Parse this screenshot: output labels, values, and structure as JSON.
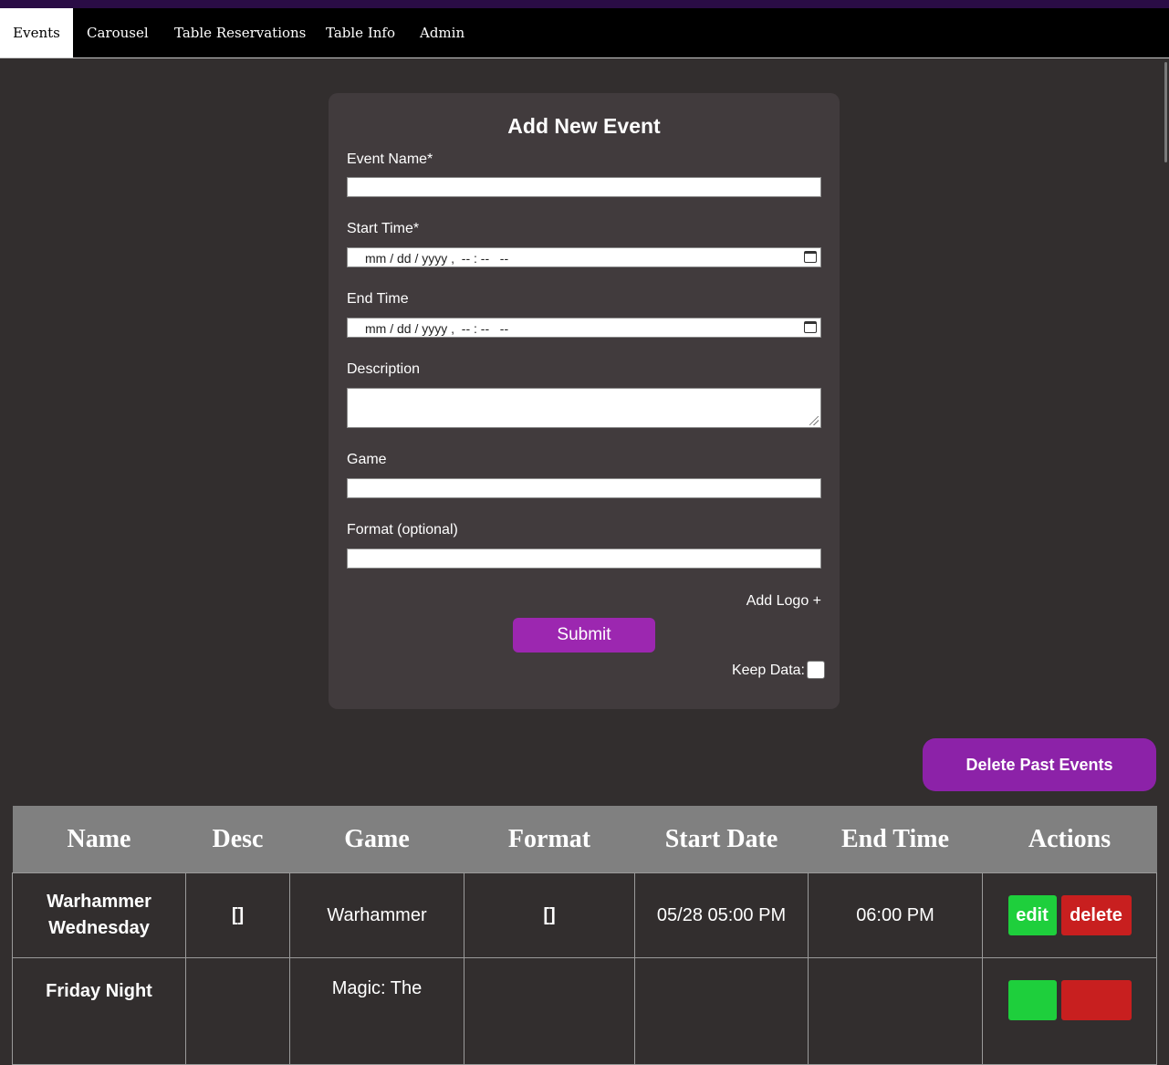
{
  "nav": {
    "items": [
      "Events",
      "Carousel",
      "Table Reservations",
      "Table Info",
      "Admin"
    ],
    "active": "Events"
  },
  "form": {
    "title": "Add New Event",
    "event_name_label": "Event Name*",
    "start_time_label": "Start Time*",
    "start_time_placeholder": "mm / dd / yyyy ,  -- : --   --",
    "end_time_label": "End Time",
    "end_time_placeholder": "mm / dd / yyyy ,  -- : --   --",
    "description_label": "Description",
    "game_label": "Game",
    "format_label": "Format (optional)",
    "add_logo": "Add Logo +",
    "submit": "Submit",
    "keep_data_label": "Keep Data:"
  },
  "delete_past_events": "Delete Past Events",
  "table": {
    "headers": [
      "Name",
      "Desc",
      "Game",
      "Format",
      "Start Date",
      "End Time",
      "Actions"
    ],
    "rows": [
      {
        "name_line1": "Warhammer",
        "name_line2": "Wednesday",
        "desc": "[]",
        "game": "Warhammer",
        "format": "[]",
        "start": "05/28 05:00 PM",
        "end": "06:00 PM",
        "edit": "edit",
        "delete": "delete"
      },
      {
        "name_line1": "Friday Night",
        "game_line1": "Magic: The"
      }
    ]
  },
  "colors": {
    "background": "#322e2e",
    "card": "#413b3d",
    "accent_purple": "#9c27b0",
    "edit_green": "#1ecf3c",
    "delete_red": "#c81f1f"
  }
}
